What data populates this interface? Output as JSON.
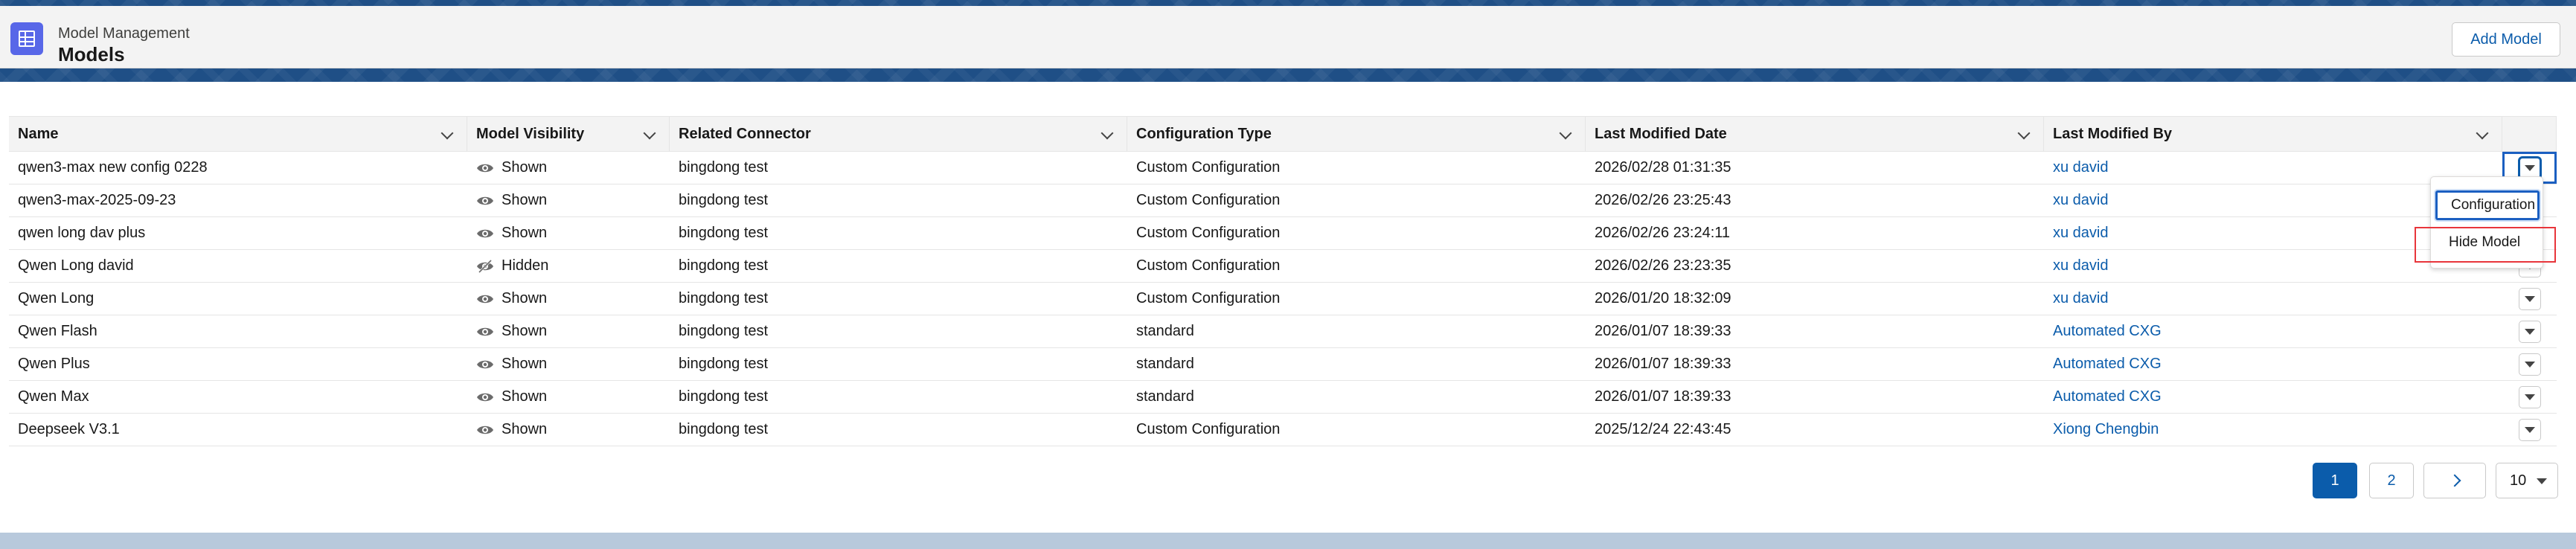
{
  "header": {
    "app_label": "Model Management",
    "title": "Models",
    "add_button": "Add Model",
    "app_icon": "grid-icon"
  },
  "table": {
    "columns": [
      "Name",
      "Model Visibility",
      "Related Connector",
      "Configuration Type",
      "Last Modified Date",
      "Last Modified By"
    ],
    "rows": [
      {
        "name": "qwen3-max new config 0228",
        "visibility": "Shown",
        "visibility_icon": "eye-icon",
        "connector": "bingdong test",
        "config_type": "Custom Configuration",
        "modified_date": "2026/02/28 01:31:35",
        "modified_by": "xu david"
      },
      {
        "name": "qwen3-max-2025-09-23",
        "visibility": "Shown",
        "visibility_icon": "eye-icon",
        "connector": "bingdong test",
        "config_type": "Custom Configuration",
        "modified_date": "2026/02/26 23:25:43",
        "modified_by": "xu david"
      },
      {
        "name": "qwen long dav plus",
        "visibility": "Shown",
        "visibility_icon": "eye-icon",
        "connector": "bingdong test",
        "config_type": "Custom Configuration",
        "modified_date": "2026/02/26 23:24:11",
        "modified_by": "xu david"
      },
      {
        "name": "Qwen Long david",
        "visibility": "Hidden",
        "visibility_icon": "eye-slash-icon",
        "connector": "bingdong test",
        "config_type": "Custom Configuration",
        "modified_date": "2026/02/26 23:23:35",
        "modified_by": "xu david"
      },
      {
        "name": "Qwen Long",
        "visibility": "Shown",
        "visibility_icon": "eye-icon",
        "connector": "bingdong test",
        "config_type": "Custom Configuration",
        "modified_date": "2026/01/20 18:32:09",
        "modified_by": "xu david"
      },
      {
        "name": "Qwen Flash",
        "visibility": "Shown",
        "visibility_icon": "eye-icon",
        "connector": "bingdong test",
        "config_type": "standard",
        "modified_date": "2026/01/07 18:39:33",
        "modified_by": "Automated CXG"
      },
      {
        "name": "Qwen Plus",
        "visibility": "Shown",
        "visibility_icon": "eye-icon",
        "connector": "bingdong test",
        "config_type": "standard",
        "modified_date": "2026/01/07 18:39:33",
        "modified_by": "Automated CXG"
      },
      {
        "name": "Qwen Max",
        "visibility": "Shown",
        "visibility_icon": "eye-icon",
        "connector": "bingdong test",
        "config_type": "standard",
        "modified_date": "2026/01/07 18:39:33",
        "modified_by": "Automated CXG"
      },
      {
        "name": "Deepseek V3.1",
        "visibility": "Shown",
        "visibility_icon": "eye-icon",
        "connector": "bingdong test",
        "config_type": "Custom Configuration",
        "modified_date": "2025/12/24 22:43:45",
        "modified_by": "Xiong Chengbin"
      }
    ]
  },
  "row_menu": {
    "items": [
      "Configuration",
      "Hide Model"
    ]
  },
  "pagination": {
    "pages": [
      "1",
      "2"
    ],
    "current": "1",
    "next_icon": "chevron-right-icon",
    "page_size": "10"
  },
  "colors": {
    "brand_blue": "#0b5cab",
    "app_icon": "#5867e8",
    "highlight_red": "#e8353b"
  }
}
